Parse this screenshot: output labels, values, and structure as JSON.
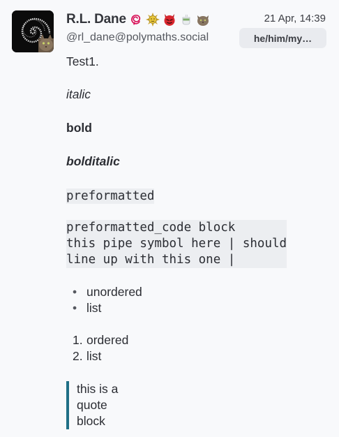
{
  "post": {
    "display_name": "R.L. Dane",
    "handle": "@rl_dane@polymaths.social",
    "timestamp": "21 Apr, 14:39",
    "pronouns": "he/him/my…",
    "avatar_icon": "spiral-avatar-icon",
    "name_emojis": [
      "debian-swirl-icon",
      "sun-face-icon",
      "devil-face-icon",
      "tea-cup-icon",
      "cat-face-icon"
    ],
    "accent_color": "#1f6f86"
  },
  "content": {
    "line1": "Test1.",
    "italic": "italic",
    "bold": "bold",
    "bolditalic": "bolditalic",
    "preformatted": "preformatted",
    "code_block": "preformatted_code block\nthis pipe symbol here | should\nline up with this one |",
    "unordered_list": [
      "unordered",
      "list"
    ],
    "ordered_list": [
      {
        "num": "1.",
        "text": "ordered"
      },
      {
        "num": "2.",
        "text": "list"
      }
    ],
    "quote_lines": [
      "this is a",
      "quote",
      "block"
    ]
  }
}
